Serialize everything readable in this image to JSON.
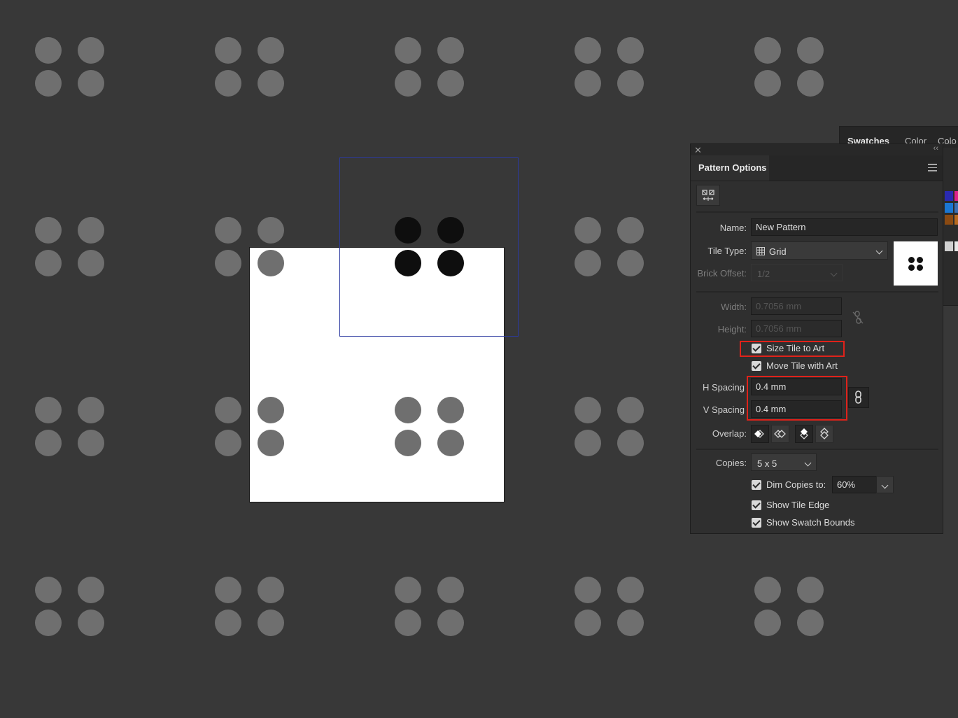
{
  "swatches_panel": {
    "tabs": [
      "Swatches",
      "Color",
      "Colo"
    ],
    "swatch_colors": [
      "#2a2ab0",
      "#e0218a",
      "#1a76d2",
      "#3b6fb3",
      "#8a4a12",
      "#b86a1f",
      "#d0d0d0",
      "#e8e8e8"
    ]
  },
  "pattern_options": {
    "title": "Pattern Options",
    "name_label": "Name:",
    "name_value": "New Pattern",
    "tile_type_label": "Tile Type:",
    "tile_type_value": "Grid",
    "brick_offset_label": "Brick Offset:",
    "brick_offset_value": "1/2",
    "width_label": "Width:",
    "width_value": "0.7056 mm",
    "height_label": "Height:",
    "height_value": "0.7056 mm",
    "size_tile_to_art": "Size Tile to Art",
    "move_tile_with_art": "Move Tile with Art",
    "h_spacing_label": "H Spacing",
    "h_spacing_value": "0.4 mm",
    "v_spacing_label": "V Spacing",
    "v_spacing_value": "0.4 mm",
    "overlap_label": "Overlap:",
    "copies_label": "Copies:",
    "copies_value": "5 x 5",
    "dim_copies_label": "Dim Copies to:",
    "dim_copies_value": "60%",
    "show_tile_edge": "Show Tile Edge",
    "show_swatch_bounds": "Show Swatch Bounds"
  },
  "accent_colors": {
    "highlight": "#e0221a",
    "tile_bounds": "#2c3aa0"
  }
}
